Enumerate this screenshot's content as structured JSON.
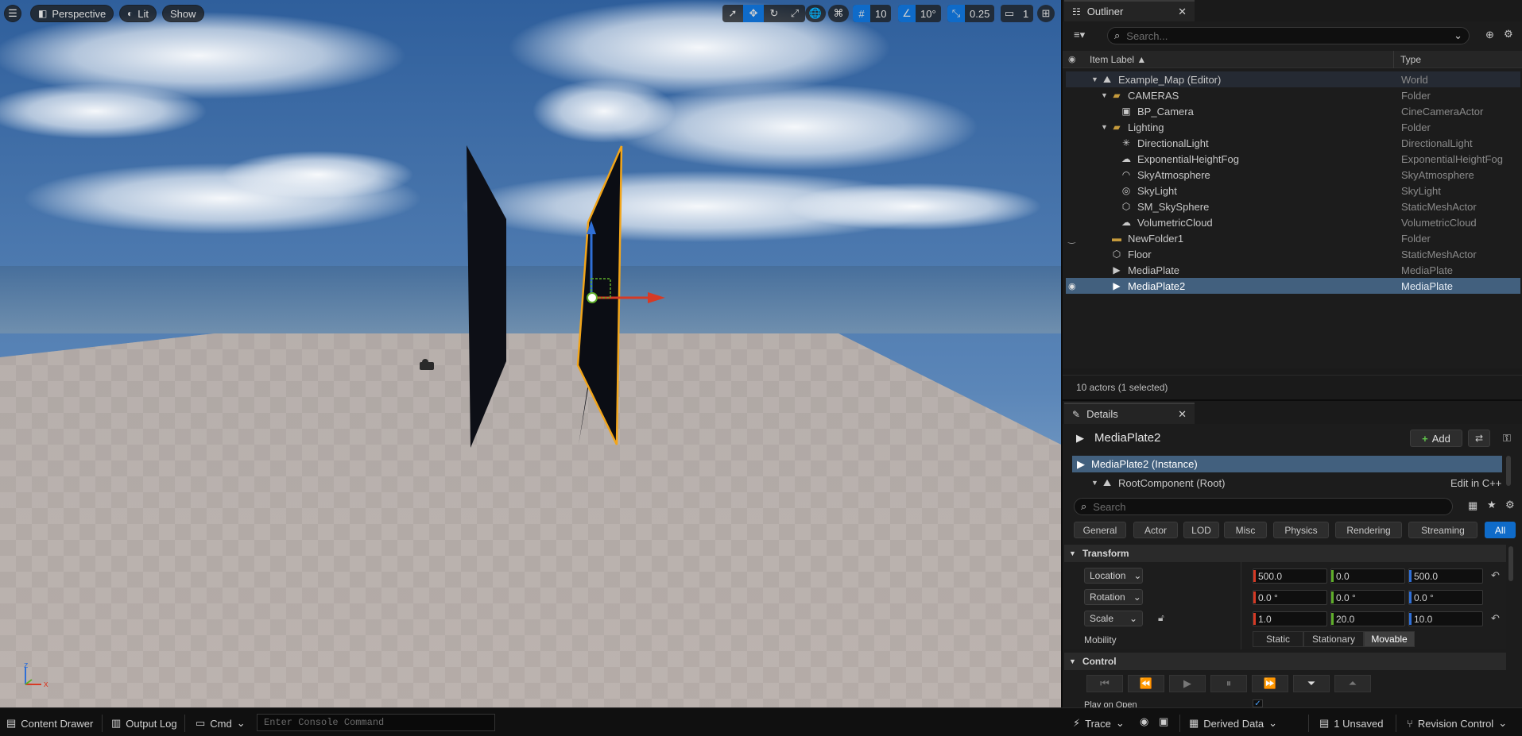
{
  "viewport": {
    "perspective_label": "Perspective",
    "lit_label": "Lit",
    "show_label": "Show",
    "grid_value": "10",
    "angle_value": "10°",
    "scale_value": "0.25",
    "camera_speed": "1",
    "axis_x": "x",
    "axis_z": "z"
  },
  "outliner": {
    "tab_title": "Outliner",
    "search_placeholder": "Search...",
    "col_label": "Item Label ▲",
    "col_type": "Type",
    "items": [
      {
        "label": "Example_Map (Editor)",
        "type": "World"
      },
      {
        "label": "CAMERAS",
        "type": "Folder"
      },
      {
        "label": "BP_Camera",
        "type": "CineCameraActor"
      },
      {
        "label": "Lighting",
        "type": "Folder"
      },
      {
        "label": "DirectionalLight",
        "type": "DirectionalLight"
      },
      {
        "label": "ExponentialHeightFog",
        "type": "ExponentialHeightFog"
      },
      {
        "label": "SkyAtmosphere",
        "type": "SkyAtmosphere"
      },
      {
        "label": "SkyLight",
        "type": "SkyLight"
      },
      {
        "label": "SM_SkySphere",
        "type": "StaticMeshActor"
      },
      {
        "label": "VolumetricCloud",
        "type": "VolumetricCloud"
      },
      {
        "label": "NewFolder1",
        "type": "Folder"
      },
      {
        "label": "Floor",
        "type": "StaticMeshActor"
      },
      {
        "label": "MediaPlate",
        "type": "MediaPlate"
      },
      {
        "label": "MediaPlate2",
        "type": "MediaPlate"
      }
    ],
    "footer": "10 actors (1 selected)"
  },
  "details": {
    "tab_title": "Details",
    "actor_name": "MediaPlate2",
    "add_label": "Add",
    "instance_label": "MediaPlate2 (Instance)",
    "root_label": "RootComponent (Root)",
    "edit_cpp": "Edit in C++",
    "search_placeholder": "Search",
    "categories": [
      "General",
      "Actor",
      "LOD",
      "Misc",
      "Physics",
      "Rendering",
      "Streaming",
      "All"
    ],
    "transform_title": "Transform",
    "location_label": "Location",
    "rotation_label": "Rotation",
    "scale_label": "Scale",
    "location": [
      "500.0",
      "0.0",
      "500.0"
    ],
    "rotation": [
      "0.0 °",
      "0.0 °",
      "0.0 °"
    ],
    "scale": [
      "1.0",
      "20.0",
      "10.0"
    ],
    "mobility_label": "Mobility",
    "mobility_options": [
      "Static",
      "Stationary",
      "Movable"
    ],
    "control_title": "Control",
    "play_on_open": "Play on Open"
  },
  "statusbar": {
    "content_drawer": "Content Drawer",
    "output_log": "Output Log",
    "cmd": "Cmd",
    "console_placeholder": "Enter Console Command",
    "trace": "Trace",
    "derived_data": "Derived Data",
    "unsaved": "1 Unsaved",
    "revision_control": "Revision Control"
  },
  "colors": {
    "accent": "#0f6bc9",
    "selection": "#42607e",
    "x_axis": "#d63a25",
    "y_axis": "#5fae2a",
    "z_axis": "#2f6fd6"
  }
}
